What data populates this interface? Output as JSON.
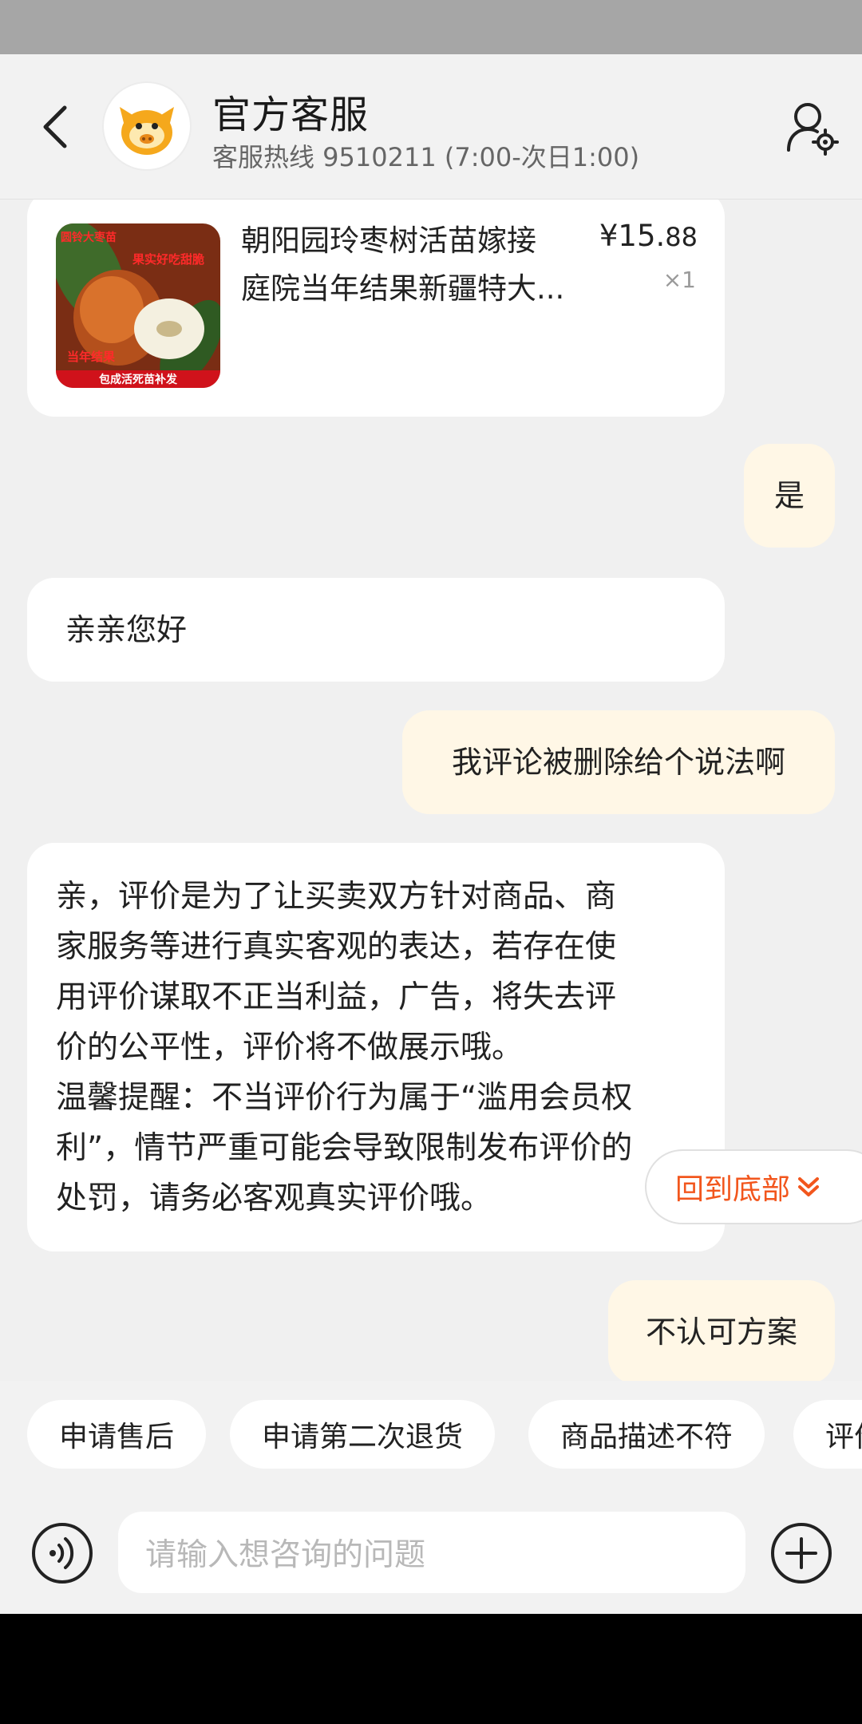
{
  "header": {
    "back_icon": "chevron-left-icon",
    "title": "官方客服",
    "subtitle": "客服热线 9510211 (7:00-次日1:00)",
    "user_settings_icon": "user-settings-icon"
  },
  "product": {
    "title_line1": "朝阳园玲枣树活苗嫁接",
    "title_line2": "庭院当年结果新疆特大...",
    "price_main": "¥15.",
    "price_decimal": "88",
    "quantity": "×1",
    "image_texts": {
      "top_left": "圆铃大枣苗",
      "top_right": "果实好吃甜脆",
      "mid_left": "当年结果",
      "bottom": "包成活死苗补发"
    }
  },
  "messages": [
    {
      "side": "mine",
      "text": "是"
    },
    {
      "side": "theirs",
      "text": "亲亲您好"
    },
    {
      "side": "mine",
      "text": "我评论被删除给个说法啊"
    },
    {
      "side": "theirs",
      "lines": [
        "亲，评价是为了让买卖双方针对商品、商",
        "家服务等进行真实客观的表达，若存在使",
        "用评价谋取不正当利益，广告，将失去评",
        "价的公平性，评价将不做展示哦。",
        "温馨提醒：不当评价行为属于“滥用会员权",
        "利”，情节严重可能会导致限制发布评价的",
        "处罚，请务必客观真实评价哦。"
      ]
    },
    {
      "side": "mine",
      "text": "不认可方案"
    }
  ],
  "back_to_bottom": "回到底部",
  "quick_replies": [
    "申请售后",
    "申请第二次退货",
    "商品描述不符",
    "评价"
  ],
  "input": {
    "placeholder": "请输入想咨询的问题"
  },
  "colors": {
    "accent": "#f2561d",
    "mine_bubble": "#fff7e6",
    "background": "#f0f0f0"
  }
}
